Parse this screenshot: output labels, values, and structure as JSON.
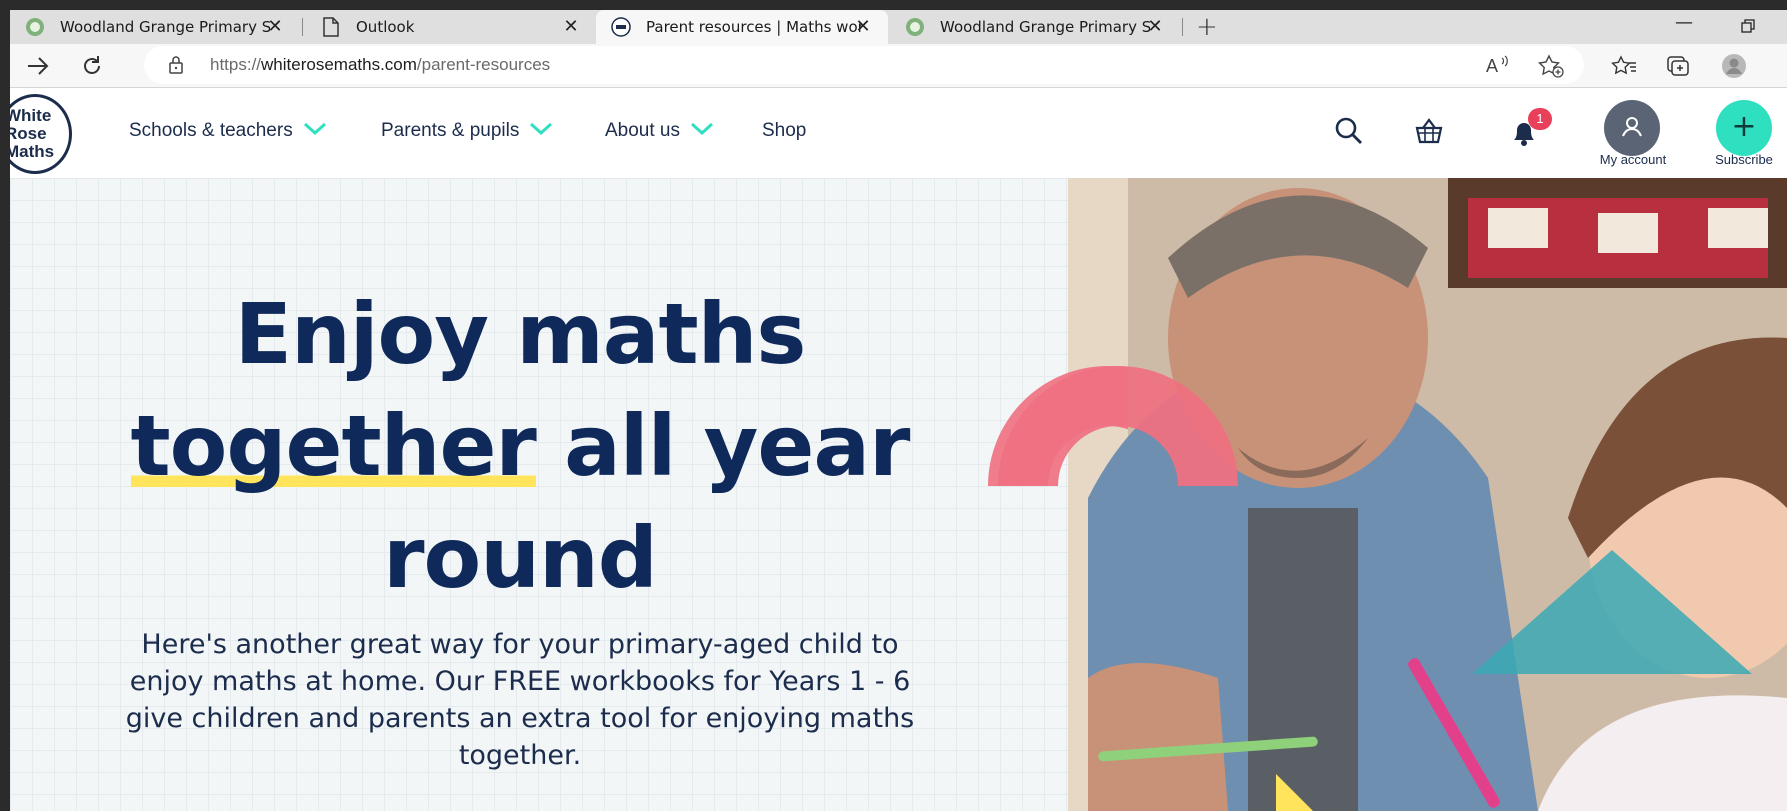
{
  "browser": {
    "tabs": [
      {
        "title": "Woodland Grange Primary Scho",
        "favicon": "school-logo-icon",
        "active": false
      },
      {
        "title": "Outlook",
        "favicon": "document-icon",
        "active": false
      },
      {
        "title": "Parent resources | Maths workbo",
        "favicon": "white-rose-icon",
        "active": true
      },
      {
        "title": "Woodland Grange Primary Scho",
        "favicon": "school-logo-icon",
        "active": false
      }
    ],
    "url_prefix": "https://",
    "url_domain": "whiterosemaths.com",
    "url_path": "/parent-resources",
    "new_tab_glyph": "+",
    "close_glyph": "✕"
  },
  "site": {
    "logo_lines": [
      "White",
      "Rose",
      "Maths"
    ],
    "nav": [
      {
        "label": "Schools & teachers",
        "has_dropdown": true
      },
      {
        "label": "Parents & pupils",
        "has_dropdown": true
      },
      {
        "label": "About us",
        "has_dropdown": true
      },
      {
        "label": "Shop",
        "has_dropdown": false
      }
    ],
    "notification_count": "1",
    "account_label": "My account",
    "subscribe_label": "Subscribe",
    "subscribe_glyph": "+"
  },
  "hero": {
    "line1": "Enjoy maths",
    "line2_highlight": "together",
    "line2_rest": " all year",
    "line3": "round",
    "intro_lines": [
      "Here's another great way for your primary-aged child to",
      "enjoy maths at home. Our FREE workbooks for Years 1 - 6",
      "give children and parents an extra tool for enjoying maths",
      "together."
    ]
  },
  "colors": {
    "navy": "#0f2a5a",
    "teal": "#2fe0c0",
    "highlight_yellow": "#ffe45c",
    "badge_red": "#e8405a",
    "shape_pink": "#f07080",
    "shape_teal": "#3aa9b4"
  }
}
